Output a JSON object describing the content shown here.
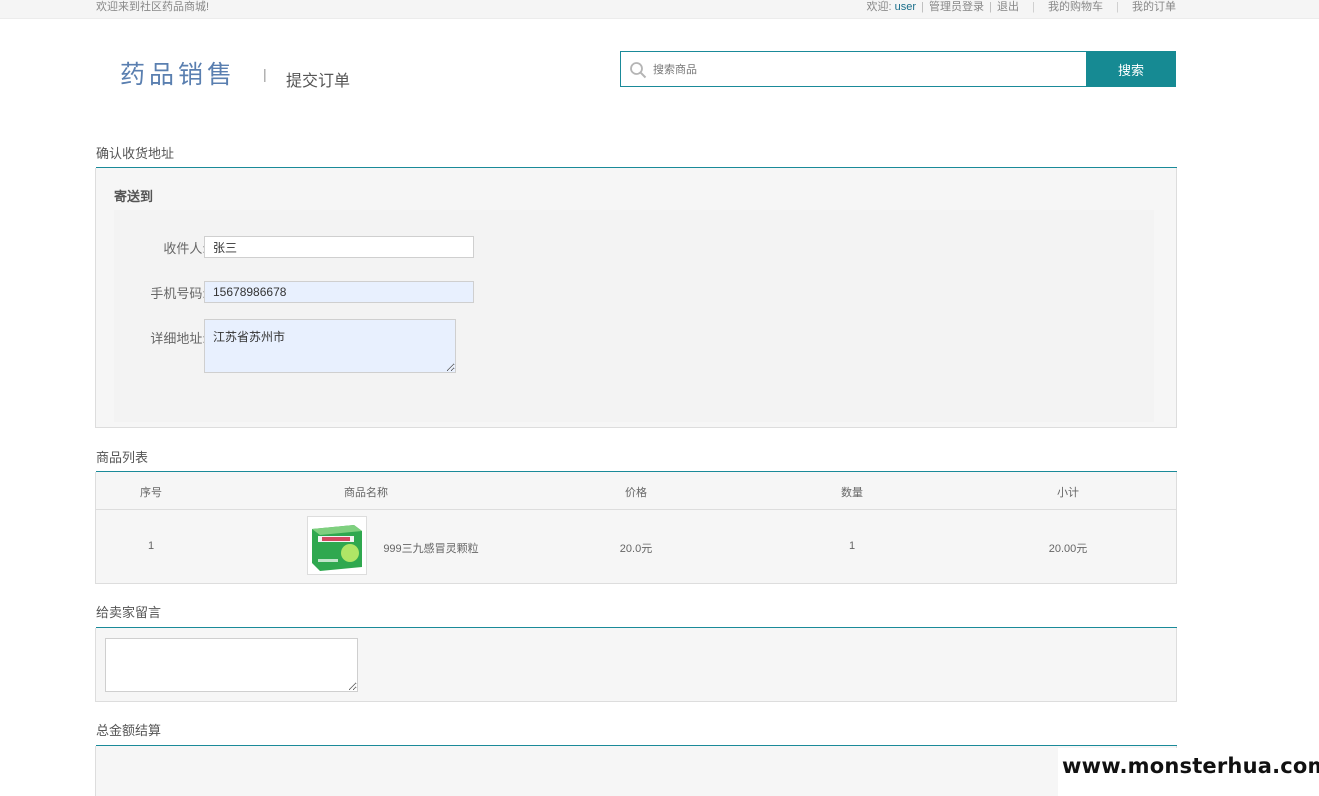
{
  "topbar": {
    "welcome": "欢迎来到社区药品商城!",
    "greeting": "欢迎:",
    "username": "user",
    "admin_login": "管理员登录",
    "logout": "退出",
    "cart": "我的购物车",
    "orders": "我的订单"
  },
  "header": {
    "logo": "药品销售",
    "separator": "|",
    "page_title": "提交订单"
  },
  "search": {
    "placeholder": "搜索商品",
    "button_label": "搜索"
  },
  "address": {
    "section_title": "确认收货地址",
    "ship_to": "寄送到",
    "recipient_label": "收件人:",
    "recipient_value": "张三",
    "phone_label": "手机号码:",
    "phone_value": "15678986678",
    "detail_label": "详细地址:",
    "detail_value": "江苏省苏州市"
  },
  "goods": {
    "section_title": "商品列表",
    "columns": [
      "序号",
      "商品名称",
      "价格",
      "数量",
      "小计"
    ],
    "rows": [
      {
        "index": "1",
        "name": "999三九感冒灵颗粒",
        "price": "20.0元",
        "quantity": "1",
        "subtotal": "20.00元"
      }
    ]
  },
  "message": {
    "section_title": "给卖家留言",
    "value": ""
  },
  "total": {
    "section_title": "总金额结算"
  },
  "watermark": {
    "text": "www.monsterhua.com"
  },
  "colors": {
    "accent": "#168a93",
    "link": "#1a6e8a",
    "autofill": "#e8f0fe"
  }
}
